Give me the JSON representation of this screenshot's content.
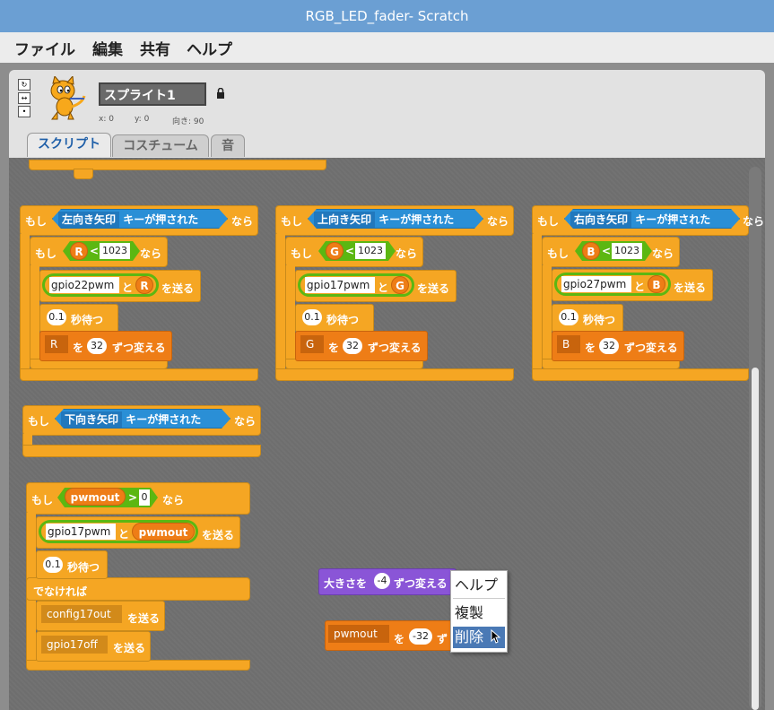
{
  "window": {
    "title": "RGB_LED_fader- Scratch"
  },
  "menu": [
    "ファイル",
    "編集",
    "共有",
    "ヘルプ"
  ],
  "sprite": {
    "name": "スプライト1",
    "x_label": "x: 0",
    "y_label": "y: 0",
    "dir_label": "向き: 90"
  },
  "tabs": [
    "スクリプト",
    "コスチューム",
    "音"
  ],
  "scripts": {
    "if_label": "もし",
    "then_label": "なら",
    "key_pressed": "キーが押された",
    "send": "を送る",
    "and": "と",
    "wait": "秒待つ",
    "change_by": "ずつ変える",
    "wo": "を",
    "lt": "<",
    "gt": ">",
    "else_label": "でなければ",
    "col1": {
      "key": "左向き矢印",
      "var": "R",
      "limit": "1023",
      "pin": "gpio22pwm",
      "wait": "0.1",
      "step": "32"
    },
    "col2": {
      "key": "上向き矢印",
      "var": "G",
      "limit": "1023",
      "pin": "gpio17pwm",
      "wait": "0.1",
      "step": "32"
    },
    "col3": {
      "key": "右向き矢印",
      "var": "B",
      "limit": "1023",
      "pin": "gpio27pwm",
      "wait": "0.1",
      "step": "32"
    },
    "down_key": "下向き矢印",
    "pwm": {
      "var": "pwmout",
      "threshold": "0",
      "pin": "gpio17pwm",
      "wait": "0.1",
      "config": "config17out",
      "off": "gpio17off"
    },
    "size_block": {
      "label": "大きさを",
      "value": "-4",
      "suffix": "ずつ変える"
    },
    "pwm_change": {
      "var": "pwmout",
      "value": "-32",
      "suffix": "ず"
    }
  },
  "context_menu": [
    "ヘルプ",
    "複製",
    "削除"
  ]
}
